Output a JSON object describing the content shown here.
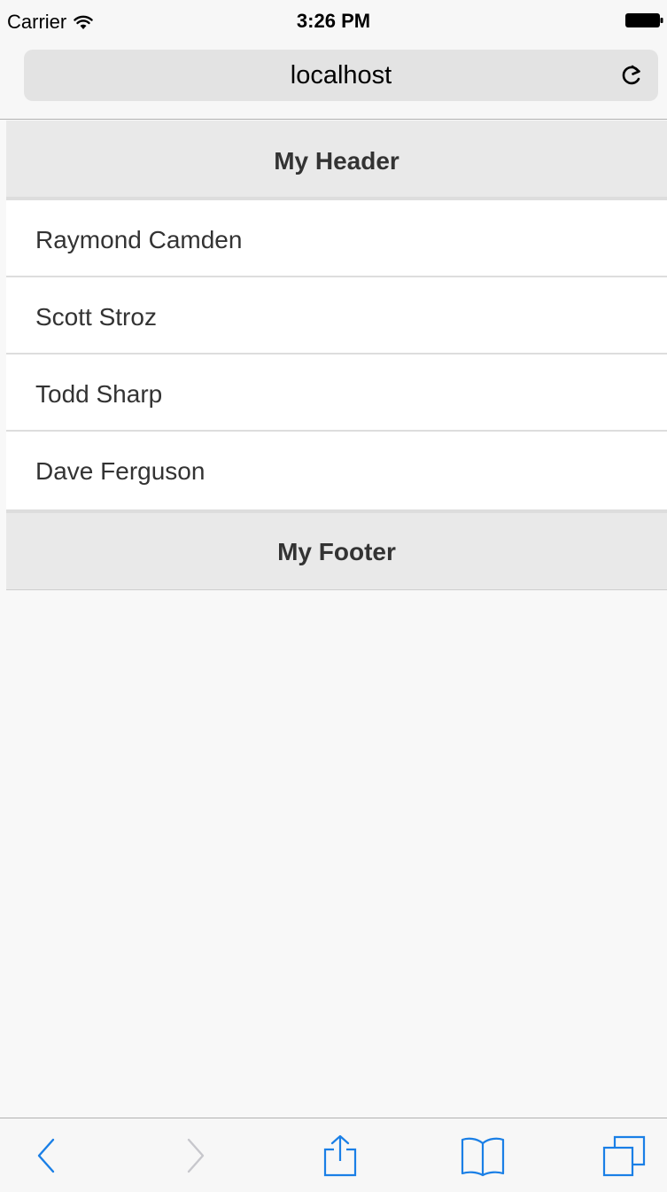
{
  "status_bar": {
    "carrier": "Carrier",
    "time": "3:26 PM",
    "icons": [
      "wifi-icon",
      "battery-icon"
    ]
  },
  "browser": {
    "address": "localhost",
    "icons": [
      "reload-icon"
    ]
  },
  "page": {
    "header_title": "My Header",
    "list_items": [
      "Raymond Camden",
      "Scott Stroz",
      "Todd Sharp",
      "Dave Ferguson"
    ],
    "footer_title": "My Footer"
  },
  "toolbar": {
    "icons": [
      "back-icon",
      "forward-icon",
      "share-icon",
      "bookmarks-icon",
      "tabs-icon"
    ]
  },
  "colors": {
    "accent": "#1a7fe6",
    "disabled": "#c7c7cc",
    "bar_background": "#e9e9e9"
  }
}
